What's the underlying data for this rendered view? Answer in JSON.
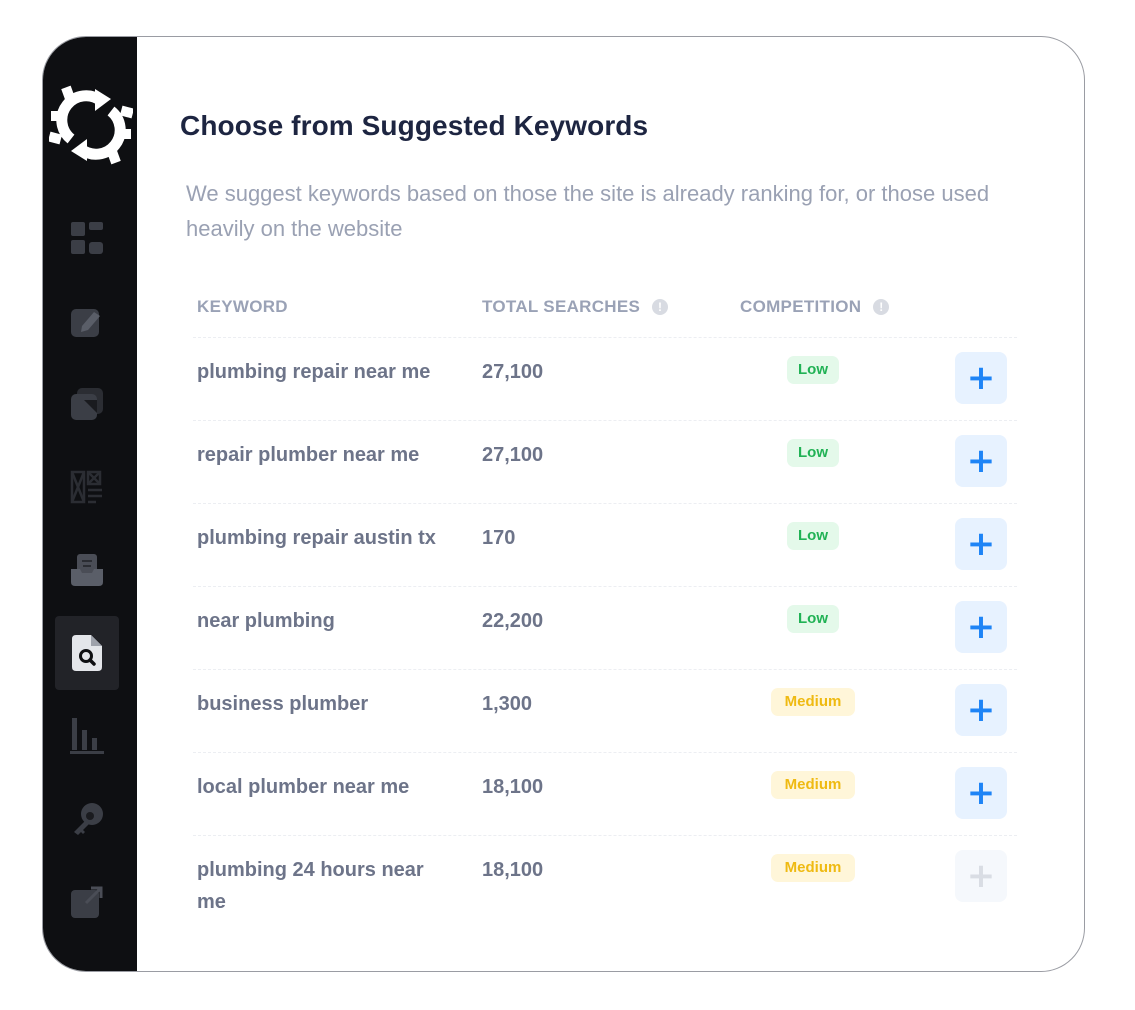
{
  "page": {
    "title": "Choose from Suggested Keywords",
    "subtitle": "We suggest keywords based on those the site is already ranking for, or those used heavily on the website"
  },
  "sidebar": {
    "items": [
      {
        "name": "dashboard-icon",
        "active": false
      },
      {
        "name": "content-editor-icon",
        "active": false
      },
      {
        "name": "pages-icon",
        "active": false
      },
      {
        "name": "schema-icon",
        "active": false
      },
      {
        "name": "inbox-icon",
        "active": false
      },
      {
        "name": "keyword-research-icon",
        "active": true
      },
      {
        "name": "analytics-icon",
        "active": false
      },
      {
        "name": "backlinks-icon",
        "active": false
      },
      {
        "name": "external-link-icon",
        "active": false
      }
    ]
  },
  "table": {
    "headers": {
      "keyword": "KEYWORD",
      "total_searches": "TOTAL SEARCHES",
      "competition": "COMPETITION"
    },
    "info_glyph": "!",
    "add_glyph": "+",
    "rows": [
      {
        "keyword": "plumbing repair near me",
        "searches": "27,100",
        "competition": "Low",
        "level": "low",
        "add_enabled": true
      },
      {
        "keyword": "repair plumber near me",
        "searches": "27,100",
        "competition": "Low",
        "level": "low",
        "add_enabled": true
      },
      {
        "keyword": "plumbing repair austin tx",
        "searches": "170",
        "competition": "Low",
        "level": "low",
        "add_enabled": true
      },
      {
        "keyword": "near plumbing",
        "searches": "22,200",
        "competition": "Low",
        "level": "low",
        "add_enabled": true
      },
      {
        "keyword": "business plumber",
        "searches": "1,300",
        "competition": "Medium",
        "level": "medium",
        "add_enabled": true
      },
      {
        "keyword": "local plumber near me",
        "searches": "18,100",
        "competition": "Medium",
        "level": "medium",
        "add_enabled": true
      },
      {
        "keyword": "plumbing 24 hours near me",
        "searches": "18,100",
        "competition": "Medium",
        "level": "medium",
        "add_enabled": false
      }
    ]
  },
  "colors": {
    "sidebar_bg": "#0e0f12",
    "title": "#1d2541",
    "accent_blue": "#1e84f6",
    "low_text": "#21b255",
    "medium_text": "#efba12"
  }
}
